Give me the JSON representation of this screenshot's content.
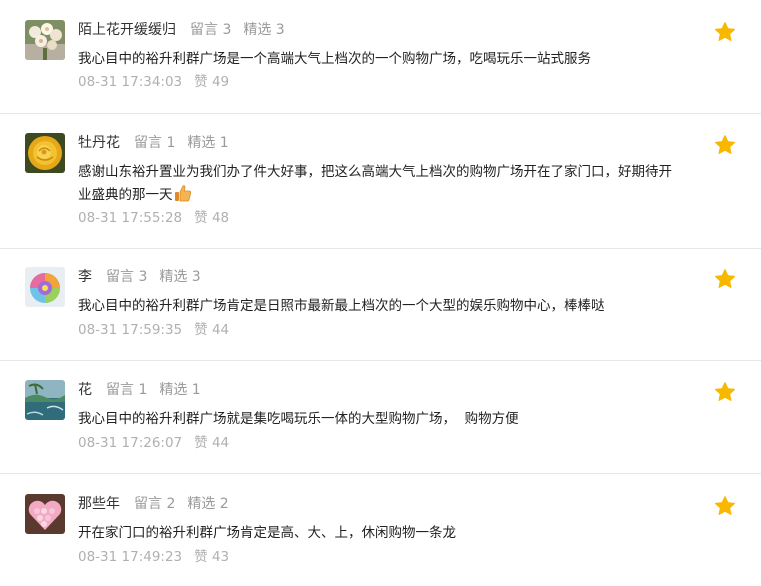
{
  "colors": {
    "star": "#f8b800",
    "nickname": "#333333",
    "meta": "#9a9a9a",
    "footer": "#b0b0b0",
    "divider": "#e6e6e6"
  },
  "comments": [
    {
      "nickname": "陌上花开缓缓归",
      "messages_label": "留言 3",
      "selected_label": "精选 3",
      "text": "我心目中的裕升利群广场是一个高端大气上档次的一个购物广场，吃喝玩乐一站式服务",
      "time": "08-31 17:34:03",
      "likes_label": "赞 49",
      "starred": true,
      "avatar_icon": "flower-bouquet-avatar"
    },
    {
      "nickname": "牡丹花",
      "messages_label": "留言 1",
      "selected_label": "精选 1",
      "text": "感谢山东裕升置业为我们办了件大好事，把这么高端大气上档次的购物广场开在了家门口，好期待开业盛典的那一天",
      "time": "08-31 17:55:28",
      "likes_label": "赞 48",
      "starred": true,
      "avatar_icon": "yellow-rose-avatar",
      "emoji": "thumbs-up-icon"
    },
    {
      "nickname": "李",
      "messages_label": "留言 3",
      "selected_label": "精选 3",
      "text": "我心目中的裕升利群广场肯定是日照市最新最上档次的一个大型的娱乐购物中心，棒棒哒",
      "time": "08-31 17:59:35",
      "likes_label": "赞 44",
      "starred": true,
      "avatar_icon": "rainbow-rose-avatar"
    },
    {
      "nickname": "花",
      "messages_label": "留言 1",
      "selected_label": "精选 1",
      "text": "我心目中的裕升利群广场就是集吃喝玩乐一体的大型购物广场，  购物方便",
      "time": "08-31 17:26:07",
      "likes_label": "赞 44",
      "starred": true,
      "avatar_icon": "landscape-avatar"
    },
    {
      "nickname": "那些年",
      "messages_label": "留言 2",
      "selected_label": "精选 2",
      "text": "开在家门口的裕升利群广场肯定是高、大、上，休闲购物一条龙",
      "time": "08-31 17:49:23",
      "likes_label": "赞 43",
      "starred": true,
      "avatar_icon": "heart-roses-avatar"
    }
  ]
}
